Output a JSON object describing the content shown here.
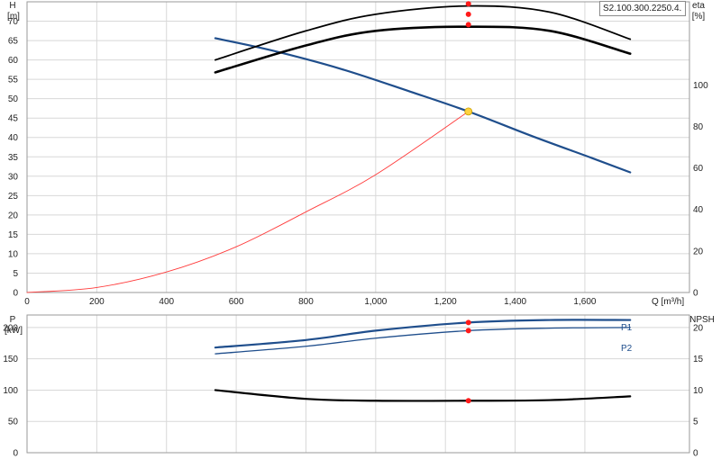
{
  "model_label": "S2.100.300.2250.4.",
  "colors": {
    "head": "#1f4e8c",
    "system": "#ff3b3b",
    "duty_point": "#ffd23f",
    "efficiency": "#000000",
    "power": "#1f4e8c",
    "npsh": "#000000",
    "marker": "#ff1a1a"
  },
  "chart_data": [
    {
      "type": "line",
      "xlabel": "Q [m³/h]",
      "xlim": [
        0,
        1900
      ],
      "x_ticks": [
        {
          "v": 0,
          "t": "0"
        },
        {
          "v": 200,
          "t": "200"
        },
        {
          "v": 400,
          "t": "400"
        },
        {
          "v": 600,
          "t": "600"
        },
        {
          "v": 800,
          "t": "800"
        },
        {
          "v": 1000,
          "t": "1,000"
        },
        {
          "v": 1200,
          "t": "1,200"
        },
        {
          "v": 1400,
          "t": "1,400"
        },
        {
          "v": 1600,
          "t": "1,600"
        }
      ],
      "y_left": {
        "label": "H",
        "unit": "[m]",
        "lim": [
          0,
          75
        ],
        "ticks": [
          "0",
          "5",
          "10",
          "15",
          "20",
          "25",
          "30",
          "35",
          "40",
          "45",
          "50",
          "55",
          "60",
          "65",
          "70"
        ]
      },
      "y_right": {
        "label": "eta",
        "unit": "[%]",
        "lim": [
          0,
          140
        ],
        "ticks": [
          "0",
          "20",
          "40",
          "60",
          "80",
          "100"
        ]
      },
      "grid": true,
      "series": [
        {
          "axis": "left",
          "x": [
            540,
            700,
            900,
            1100,
            1266,
            1450,
            1620,
            1730
          ],
          "y": [
            65.6,
            62.5,
            57.7,
            51.8,
            46.7,
            40.3,
            34.7,
            31.0
          ]
        },
        {
          "axis": "left",
          "x": [
            0,
            200,
            400,
            600,
            800,
            1000,
            1266
          ],
          "y": [
            0,
            1.3,
            5.3,
            11.8,
            20.8,
            30.4,
            46.7
          ]
        },
        {
          "axis": "right",
          "x": [
            540,
            800,
            1000,
            1266,
            1500,
            1730
          ],
          "y": [
            112,
            126,
            134,
            138,
            135,
            122
          ]
        },
        {
          "axis": "right",
          "x": [
            540,
            800,
            1000,
            1266,
            1500,
            1730
          ],
          "y": [
            106,
            119,
            126,
            128,
            126,
            115
          ]
        }
      ],
      "duty_point": {
        "x": 1266,
        "y": 46.7
      },
      "markers": [
        {
          "axis": "right",
          "x": 1266,
          "y": 139
        },
        {
          "axis": "right",
          "x": 1266,
          "y": 134
        },
        {
          "axis": "right",
          "x": 1266,
          "y": 129
        }
      ]
    },
    {
      "type": "line",
      "xlim": [
        0,
        1900
      ],
      "y_left": {
        "label": "P",
        "unit": "[kW]",
        "lim": [
          0,
          220
        ],
        "ticks": [
          "0",
          "50",
          "100",
          "150",
          "200"
        ]
      },
      "y_right": {
        "label": "NPSH",
        "unit": "",
        "lim": [
          0,
          22
        ],
        "ticks": [
          "0",
          "5",
          "10",
          "15",
          "20"
        ]
      },
      "grid": true,
      "series": [
        {
          "name": "P1",
          "axis": "left",
          "x": [
            540,
            800,
            1000,
            1266,
            1500,
            1730
          ],
          "y": [
            168,
            180,
            195,
            208,
            212,
            212
          ]
        },
        {
          "name": "P2",
          "axis": "left",
          "x": [
            540,
            800,
            1000,
            1266,
            1500,
            1730
          ],
          "y": [
            158,
            170,
            183,
            195,
            199,
            200
          ]
        },
        {
          "axis": "right",
          "x": [
            540,
            800,
            1000,
            1266,
            1500,
            1730
          ],
          "y": [
            10.0,
            8.6,
            8.3,
            8.3,
            8.4,
            9.0
          ]
        }
      ],
      "markers": [
        {
          "axis": "left",
          "x": 1266,
          "y": 208
        },
        {
          "axis": "left",
          "x": 1266,
          "y": 195
        },
        {
          "axis": "right",
          "x": 1266,
          "y": 8.3
        }
      ]
    }
  ]
}
